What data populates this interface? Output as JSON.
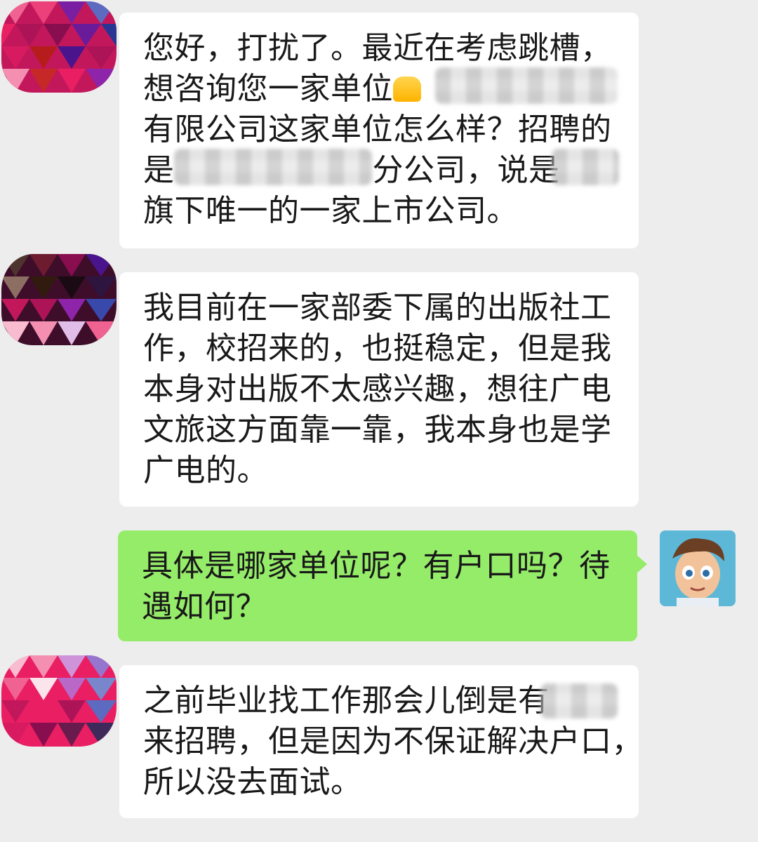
{
  "messages": [
    {
      "sender": "other",
      "lines": [
        "您好，打扰了。最近在考虑跳槽，",
        "想咨询您一家单位",
        "有限公司这家单位怎么样？招聘的",
        "是",
        "分公司，说是",
        "旗下唯一的一家上市公司。"
      ]
    },
    {
      "sender": "other",
      "lines": [
        "我目前在一家部委下属的出版社工",
        "作，校招来的，也挺稳定，但是我",
        "本身对出版不太感兴趣，想往广电",
        "文旅这方面靠一靠，我本身也是学",
        "广电的。"
      ]
    },
    {
      "sender": "self",
      "lines": [
        "具体是哪家单位呢？有户口吗？待",
        "遇如何？"
      ]
    },
    {
      "sender": "other",
      "lines": [
        "之前毕业找工作那会儿倒是有",
        "来招聘，但是因为不保证解决户口，",
        "所以没去面试。"
      ]
    }
  ],
  "colors": {
    "background": "#ededed",
    "received_bubble": "#ffffff",
    "sent_bubble": "#95ec69",
    "text": "#191919"
  },
  "icons": [
    "avatar-contact",
    "avatar-self-cartoon",
    "pray-emoji"
  ]
}
